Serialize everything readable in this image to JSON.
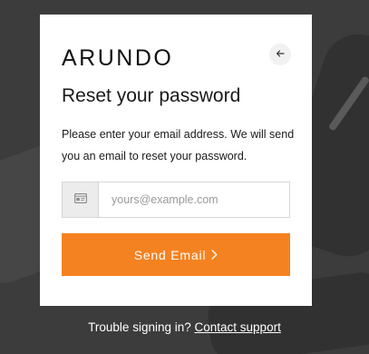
{
  "brand": {
    "logo_text": "ARUNDO",
    "accent_color": "#f58220"
  },
  "dialog": {
    "title": "Reset your password",
    "description": "Please enter your email address. We will send you an email to reset your password.",
    "back_icon": "arrow-left-icon"
  },
  "email_field": {
    "icon": "email-card-icon",
    "placeholder": "yours@example.com",
    "value": ""
  },
  "submit": {
    "label": "Send Email",
    "icon": "chevron-right-icon"
  },
  "footer": {
    "prompt": "Trouble signing in?",
    "link_label": "Contact support"
  }
}
